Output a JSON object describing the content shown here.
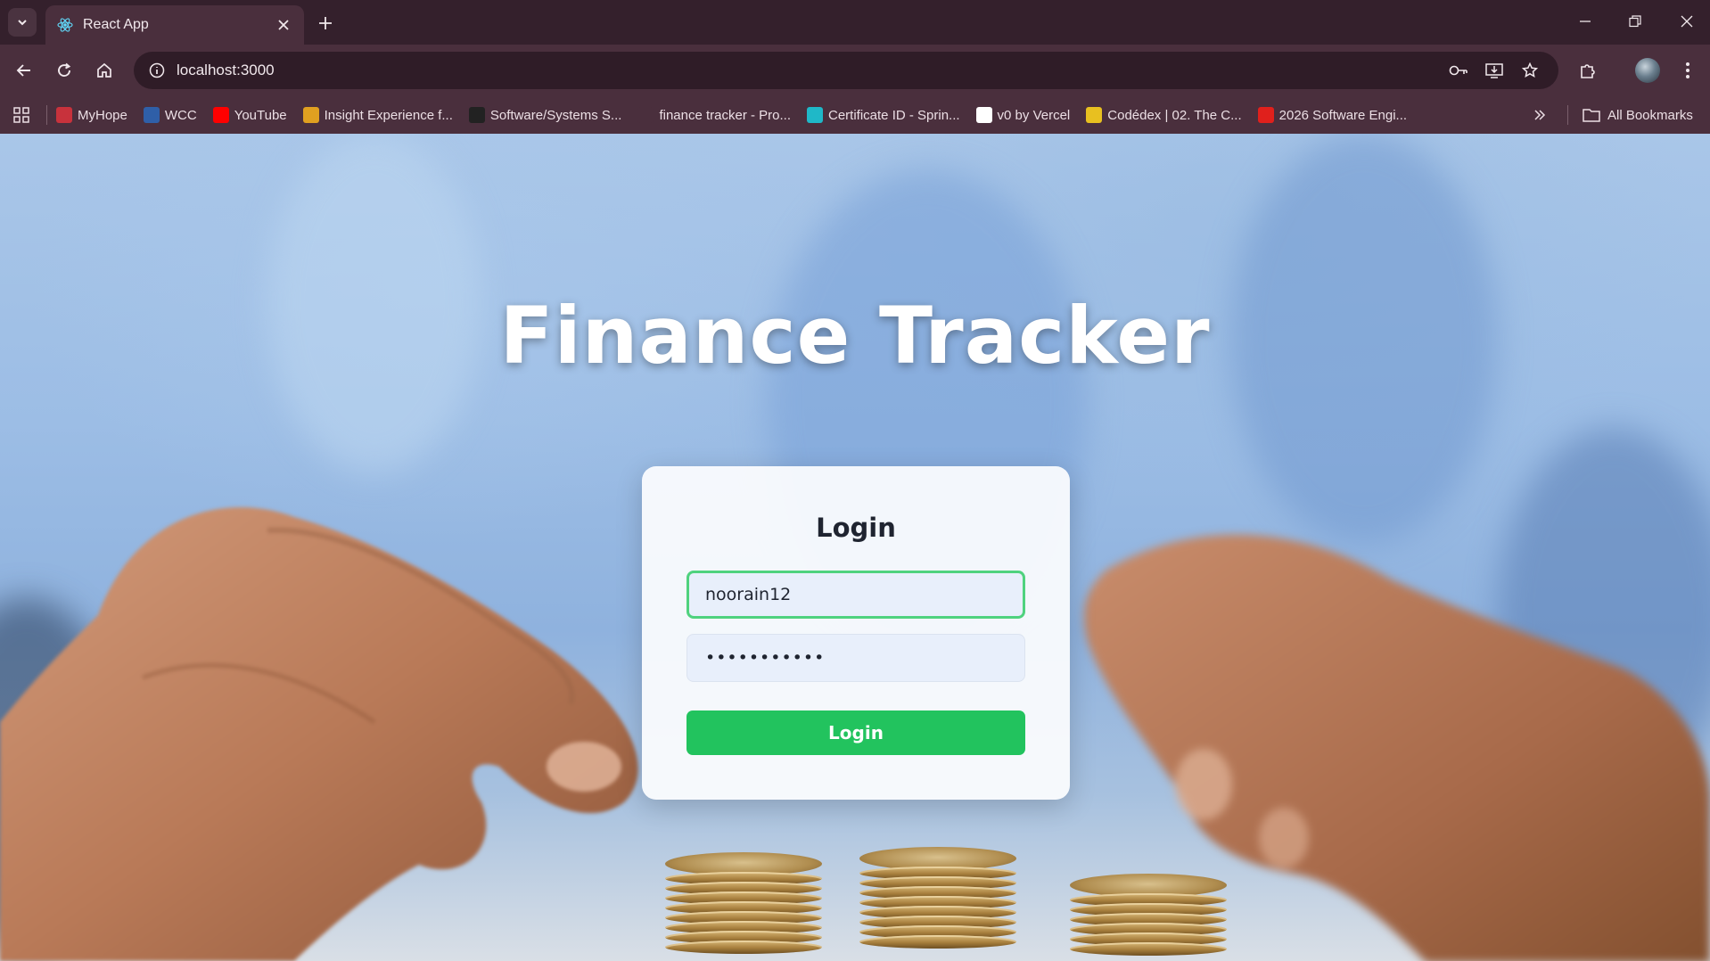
{
  "browser": {
    "tab_title": "React App",
    "url": "localhost:3000",
    "bookmarks": [
      {
        "label": "MyHope",
        "icon": "myhope-icon",
        "color": "#c8323c"
      },
      {
        "label": "WCC",
        "icon": "wcc-icon",
        "color": "#2f5fa8"
      },
      {
        "label": "YouTube",
        "icon": "youtube-icon",
        "color": "#ff0000"
      },
      {
        "label": "Insight Experience f...",
        "icon": "insight-icon",
        "color": "#e0a020"
      },
      {
        "label": "Software/Systems S...",
        "icon": "software-icon",
        "color": "#222222"
      },
      {
        "label": "finance tracker - Pro...",
        "icon": "openai-icon",
        "color": "#4a2f3d"
      },
      {
        "label": "Certificate ID - Sprin...",
        "icon": "certificate-icon",
        "color": "#1fb8c8"
      },
      {
        "label": "v0 by Vercel",
        "icon": "v0-icon",
        "color": "#ffffff"
      },
      {
        "label": "Codédex | 02. The C...",
        "icon": "codedex-icon",
        "color": "#e8c020"
      },
      {
        "label": "2026 Software Engi...",
        "icon": "oracle-icon",
        "color": "#e0201c"
      }
    ],
    "all_bookmarks_label": "All Bookmarks"
  },
  "page": {
    "title": "Finance Tracker",
    "login": {
      "heading": "Login",
      "username_value": "noorain12",
      "password_value": "•••••••••••",
      "submit_label": "Login"
    }
  }
}
